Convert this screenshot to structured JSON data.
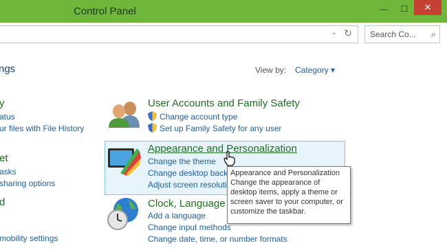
{
  "window": {
    "title": "Control Panel",
    "minimize": "—",
    "maximize": "☐",
    "close": "✕"
  },
  "addressbar": {
    "chevron": "⌄",
    "refresh": "↻"
  },
  "search": {
    "placeholder": "Search Co...",
    "icon": "⌕"
  },
  "header": {
    "heading": "ngs",
    "view_by_label": "View by:",
    "view_by_value": "Category ▾"
  },
  "left_column": [
    {
      "title": "y",
      "links": [
        "atus",
        "ur files with File History"
      ]
    },
    {
      "title": "et",
      "links": [
        "asks",
        "sharing options"
      ]
    },
    {
      "title": "d",
      "links": [
        "mobility settings"
      ]
    }
  ],
  "categories": [
    {
      "title": "User Accounts and Family Safety",
      "links": [
        "Change account type",
        "Set up Family Safety for any user"
      ]
    },
    {
      "title": "Appearance and Personalization",
      "links": [
        "Change the theme",
        "Change desktop back",
        "Adjust screen resoluti"
      ]
    },
    {
      "title": "Clock, Language",
      "links": [
        "Add a language",
        "Change input methods",
        "Change date, time, or number formats"
      ]
    }
  ],
  "tooltip": {
    "title": "Appearance and Personalization",
    "body": "Change the appearance of desktop items, apply a theme or screen saver to your computer, or customize the taskbar."
  },
  "colors": {
    "titlebar": "#6fb73a",
    "close_button": "#c74133",
    "category_green": "#1f6e1f",
    "link_blue": "#1d5fa8",
    "highlight_bg": "#e7f3fb"
  }
}
